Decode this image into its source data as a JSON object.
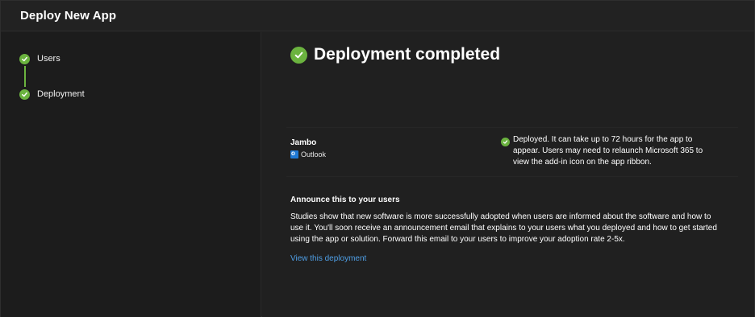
{
  "header": {
    "title": "Deploy New App"
  },
  "steps": [
    {
      "label": "Users",
      "status_icon": "check-circle-icon"
    },
    {
      "label": "Deployment",
      "status_icon": "check-circle-icon"
    }
  ],
  "main": {
    "title": "Deployment completed",
    "app": {
      "name": "Jambo",
      "host": "Outlook",
      "host_icon": "outlook-icon",
      "status": "Deployed. It can take up to 72 hours for the app to appear. Users may need to relaunch Microsoft 365 to view the add-in icon on the app ribbon."
    },
    "announce": {
      "title": "Announce this to your users",
      "body": "Studies show that new software is more successfully adopted when users are informed about the software and how to use it. You'll soon receive an announcement email that explains to your users what you deployed and how to get started using the app or solution. Forward this email to your users to improve your adoption rate 2-5x.",
      "link": "View this deployment"
    }
  },
  "colors": {
    "success": "#6bb33f",
    "link": "#4f9fe6",
    "background": "#202020"
  }
}
